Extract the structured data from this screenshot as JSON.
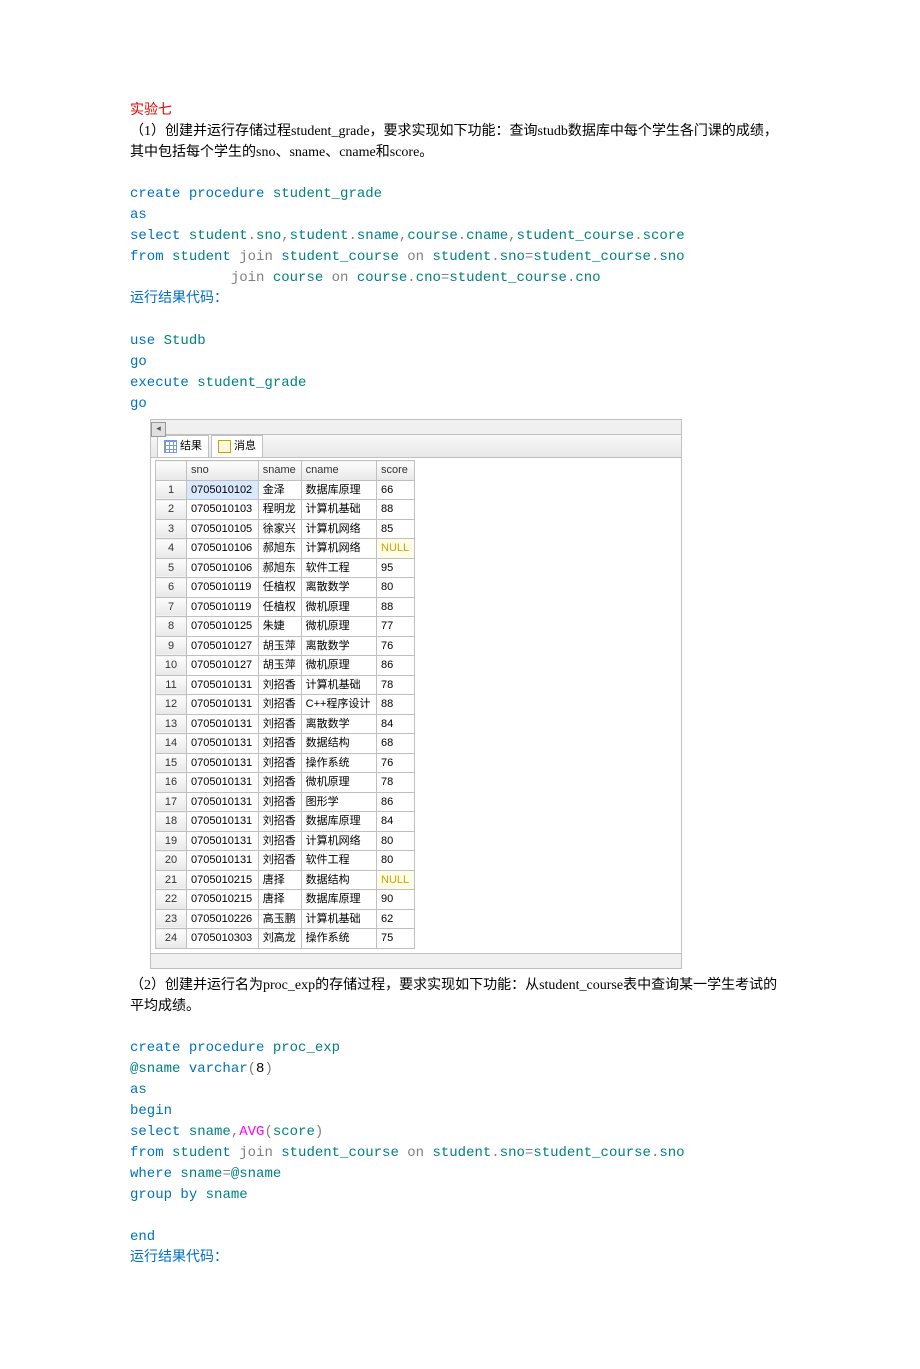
{
  "section1": {
    "title": "实验七",
    "desc": "（1）创建并运行存储过程student_grade，要求实现如下功能：查询studb数据库中每个学生各门课的成绩，其中包括每个学生的sno、sname、cname和score。",
    "code": {
      "l1_a": "create",
      "l1_b": " procedure",
      "l1_c": " student_grade",
      "l2": "as",
      "l3_a": "select",
      "l3_b": " student",
      "l3_c": ".",
      "l3_d": "sno",
      "l3_e": ",",
      "l3_f": "student",
      "l3_g": ".",
      "l3_h": "sname",
      "l3_i": ",",
      "l3_j": "course",
      "l3_k": ".",
      "l3_l": "cname",
      "l3_m": ",",
      "l3_n": "student_course",
      "l3_o": ".",
      "l3_p": "score",
      "l4_a": "from",
      "l4_b": " student ",
      "l4_c": "join",
      "l4_d": " student_course ",
      "l4_e": "on",
      "l4_f": " student",
      "l4_g": ".",
      "l4_h": "sno",
      "l4_i": "=",
      "l4_j": "student_course",
      "l4_k": ".",
      "l4_l": "sno",
      "l5_pad": "            ",
      "l5_a": "join",
      "l5_b": " course ",
      "l5_c": "on",
      "l5_d": " course",
      "l5_e": ".",
      "l5_f": "cno",
      "l5_g": "=",
      "l5_h": "student_course",
      "l5_i": ".",
      "l5_j": "cno"
    },
    "run_label": "运行结果代码：",
    "run_code": {
      "l1_a": "use",
      "l1_b": " Studb",
      "l2": "go",
      "l3_a": "execute",
      "l3_b": " student_grade",
      "l4": "go"
    }
  },
  "results": {
    "tab_result": "结果",
    "tab_msg": "消息",
    "cols": [
      "",
      "sno",
      "sname",
      "cname",
      "score"
    ],
    "rows": [
      [
        "1",
        "0705010102",
        "金泽",
        "数据库原理",
        "66"
      ],
      [
        "2",
        "0705010103",
        "程明龙",
        "计算机基础",
        "88"
      ],
      [
        "3",
        "0705010105",
        "徐家兴",
        "计算机网络",
        "85"
      ],
      [
        "4",
        "0705010106",
        "郝旭东",
        "计算机网络",
        "NULL"
      ],
      [
        "5",
        "0705010106",
        "郝旭东",
        "软件工程",
        "95"
      ],
      [
        "6",
        "0705010119",
        "任植权",
        "离散数学",
        "80"
      ],
      [
        "7",
        "0705010119",
        "任植权",
        "微机原理",
        "88"
      ],
      [
        "8",
        "0705010125",
        "朱婕",
        "微机原理",
        "77"
      ],
      [
        "9",
        "0705010127",
        "胡玉萍",
        "离散数学",
        "76"
      ],
      [
        "10",
        "0705010127",
        "胡玉萍",
        "微机原理",
        "86"
      ],
      [
        "11",
        "0705010131",
        "刘招香",
        "计算机基础",
        "78"
      ],
      [
        "12",
        "0705010131",
        "刘招香",
        "C++程序设计",
        "88"
      ],
      [
        "13",
        "0705010131",
        "刘招香",
        "离散数学",
        "84"
      ],
      [
        "14",
        "0705010131",
        "刘招香",
        "数据结构",
        "68"
      ],
      [
        "15",
        "0705010131",
        "刘招香",
        "操作系统",
        "76"
      ],
      [
        "16",
        "0705010131",
        "刘招香",
        "微机原理",
        "78"
      ],
      [
        "17",
        "0705010131",
        "刘招香",
        "图形学",
        "86"
      ],
      [
        "18",
        "0705010131",
        "刘招香",
        "数据库原理",
        "84"
      ],
      [
        "19",
        "0705010131",
        "刘招香",
        "计算机网络",
        "80"
      ],
      [
        "20",
        "0705010131",
        "刘招香",
        "软件工程",
        "80"
      ],
      [
        "21",
        "0705010215",
        "唐择",
        "数据结构",
        "NULL"
      ],
      [
        "22",
        "0705010215",
        "唐择",
        "数据库原理",
        "90"
      ],
      [
        "23",
        "0705010226",
        "高玉鹏",
        "计算机基础",
        "62"
      ],
      [
        "24",
        "0705010303",
        "刘高龙",
        "操作系统",
        "75"
      ]
    ]
  },
  "section2": {
    "desc": "（2）创建并运行名为proc_exp的存储过程，要求实现如下功能：从student_course表中查询某一学生考试的平均成绩。",
    "code": {
      "l1_a": "create",
      "l1_b": " procedure",
      "l1_c": " proc_exp",
      "l2_a": "@sname ",
      "l2_b": "varchar",
      "l2_c": "(",
      "l2_d": "8",
      "l2_e": ")",
      "l3": "as",
      "l4": "begin",
      "l5_a": "select",
      "l5_b": " sname",
      "l5_c": ",",
      "l5_d": "AVG",
      "l5_e": "(",
      "l5_f": "score",
      "l5_g": ")",
      "l6_a": "from",
      "l6_b": " student ",
      "l6_c": "join",
      "l6_d": " student_course ",
      "l6_e": "on",
      "l6_f": " student",
      "l6_g": ".",
      "l6_h": "sno",
      "l6_i": "=",
      "l6_j": "student_course",
      "l6_k": ".",
      "l6_l": "sno",
      "l7_a": "where",
      "l7_b": " sname",
      "l7_c": "=",
      "l7_d": "@sname",
      "l8_a": "group",
      "l8_b": " by",
      "l8_c": " sname",
      "l10": "end"
    },
    "run_label": "运行结果代码："
  }
}
